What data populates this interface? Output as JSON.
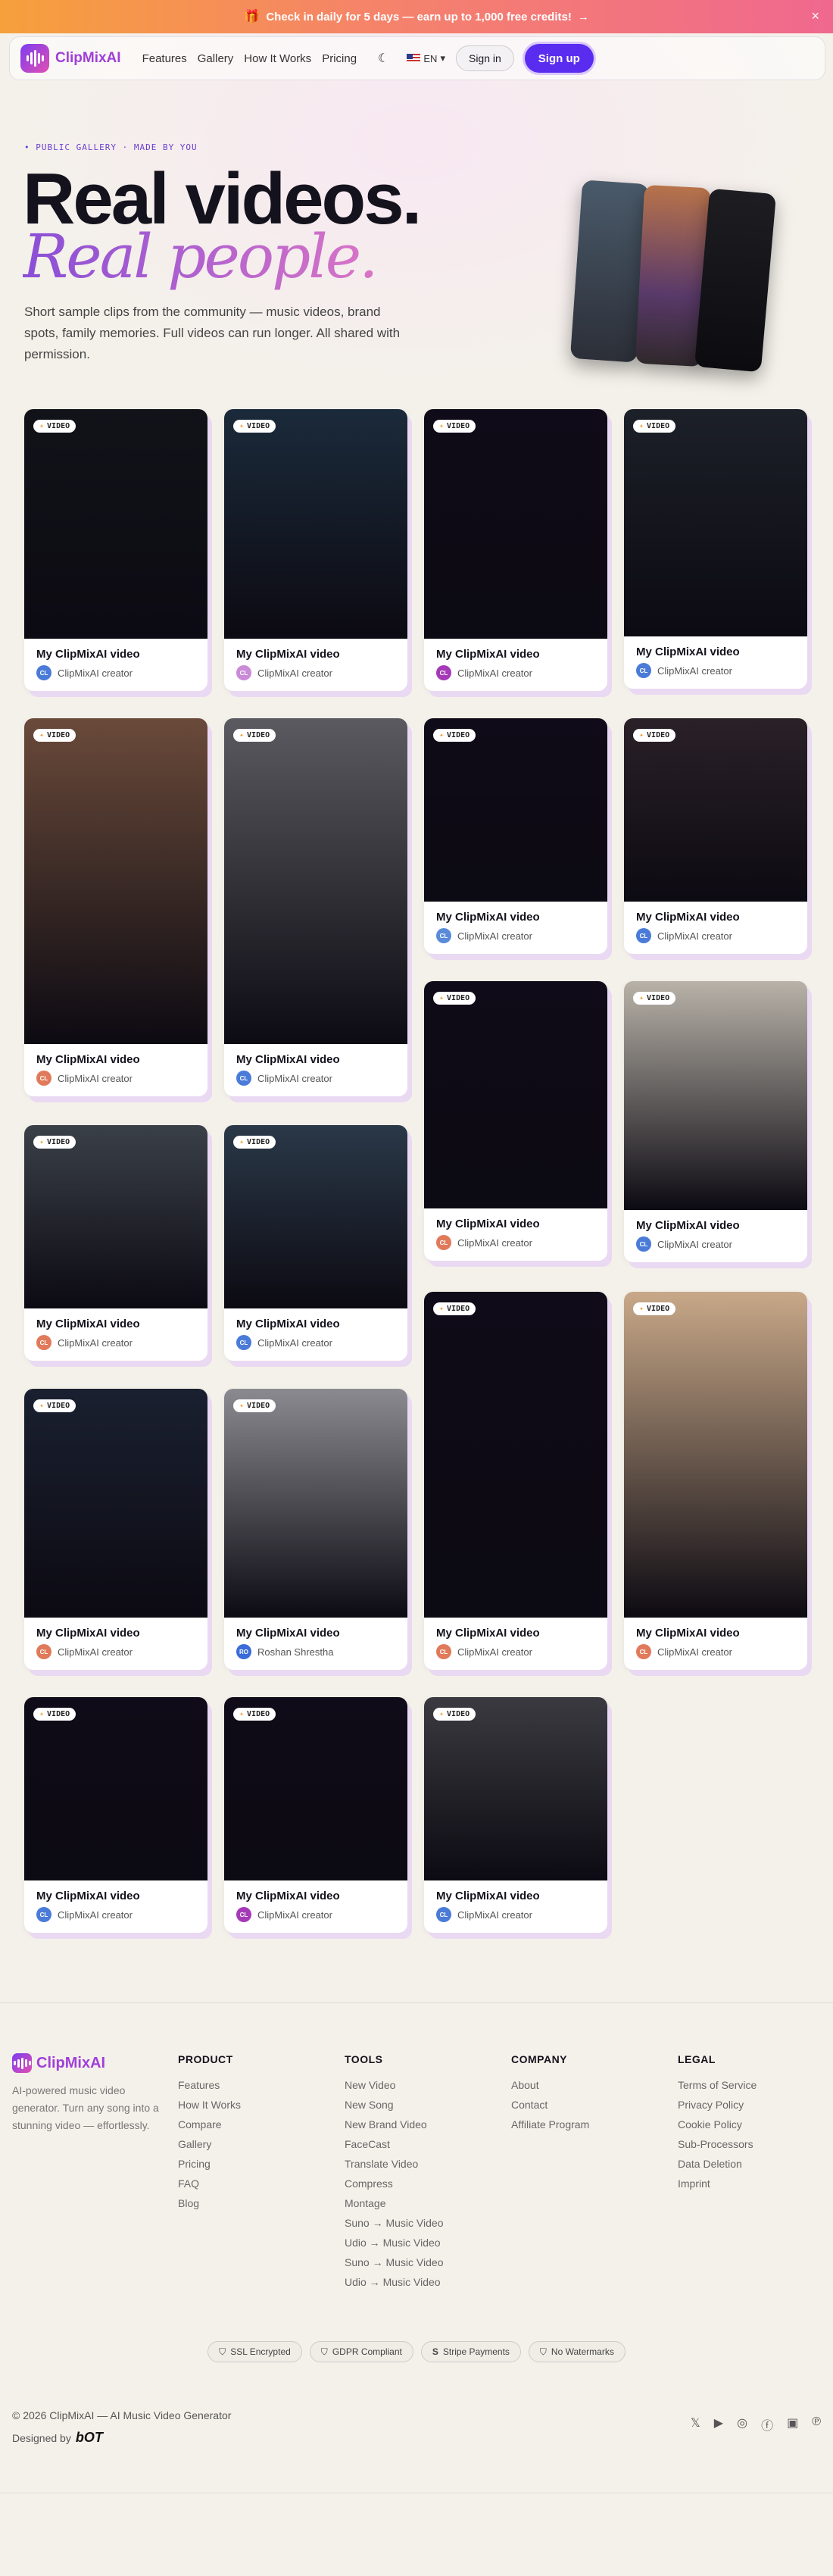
{
  "banner": {
    "icon": "gift-icon",
    "text": "Check in daily for 5 days — earn up to 1,000 free credits!",
    "arrow": "→",
    "close": "×"
  },
  "nav": {
    "brand": "ClipMixAI",
    "links": [
      "Features",
      "Gallery",
      "How It Works",
      "Pricing"
    ],
    "theme_icon": "moon-icon",
    "lang": "EN",
    "signin": "Sign in",
    "signup": "Sign up"
  },
  "hero": {
    "eyebrow": "• PUBLIC GALLERY · MADE BY YOU",
    "title_line1": "Real videos.",
    "title_line2": "Real people.",
    "lede": "Short sample clips from the community — music videos, brand spots, family memories. Full videos can run longer. All shared with permission."
  },
  "cards": [
    {
      "badge": "VIDEO",
      "title": "My ClipMixAI video",
      "author": "ClipMixAI creator",
      "initials": "CL",
      "avatar": "#4a7bd8",
      "thumb": "#111319"
    },
    {
      "badge": "VIDEO",
      "title": "My ClipMixAI video",
      "author": "ClipMixAI creator",
      "initials": "CL",
      "avatar": "#c98ad8",
      "thumb": "#1b2a3a"
    },
    {
      "badge": "VIDEO",
      "title": "My ClipMixAI video",
      "author": "ClipMixAI creator",
      "initials": "CL",
      "avatar": "#a53ab8",
      "thumb": "#0f0b18"
    },
    {
      "badge": "VIDEO",
      "title": "My ClipMixAI video",
      "author": "ClipMixAI creator",
      "initials": "CL",
      "avatar": "#4a7bd8",
      "thumb": "#1c2028"
    },
    {
      "badge": "VIDEO",
      "title": "My ClipMixAI video",
      "author": "ClipMixAI creator",
      "initials": "CL",
      "avatar": "#e07a5a",
      "thumb": "#6a4a3a"
    },
    {
      "badge": "VIDEO",
      "title": "My ClipMixAI video",
      "author": "ClipMixAI creator",
      "initials": "CL",
      "avatar": "#4a7bd8",
      "thumb": "#5a5a60"
    },
    {
      "badge": "VIDEO",
      "title": "My ClipMixAI video",
      "author": "ClipMixAI creator",
      "initials": "CL",
      "avatar": "#5a8bd8",
      "thumb": "#0f0b18"
    },
    {
      "badge": "VIDEO",
      "title": "My ClipMixAI video",
      "author": "ClipMixAI creator",
      "initials": "CL",
      "avatar": "#4a7bd8",
      "thumb": "#2a2028"
    },
    {
      "badge": "VIDEO",
      "title": "My ClipMixAI video",
      "author": "ClipMixAI creator",
      "initials": "CL",
      "avatar": "#e07a5a",
      "thumb": "#0f0b18"
    },
    {
      "badge": "VIDEO",
      "title": "My ClipMixAI video",
      "author": "ClipMixAI creator",
      "initials": "CL",
      "avatar": "#4a7bd8",
      "thumb": "#b8b2a8"
    },
    {
      "badge": "VIDEO",
      "title": "My ClipMixAI video",
      "author": "ClipMixAI creator",
      "initials": "CL",
      "avatar": "#e07a5a",
      "thumb": "#3a4048"
    },
    {
      "badge": "VIDEO",
      "title": "My ClipMixAI video",
      "author": "ClipMixAI creator",
      "initials": "CL",
      "avatar": "#4a7bd8",
      "thumb": "#2a3848"
    },
    {
      "badge": "VIDEO",
      "title": "My ClipMixAI video",
      "author": "ClipMixAI creator",
      "initials": "CL",
      "avatar": "#e07a5a",
      "thumb": "#0f0b18"
    },
    {
      "badge": "VIDEO",
      "title": "My ClipMixAI video",
      "author": "ClipMixAI creator",
      "initials": "CL",
      "avatar": "#a53ab8",
      "thumb": "#6a5a48"
    },
    {
      "badge": "VIDEO",
      "title": "My ClipMixAI video",
      "author": "ClipMixAI creator",
      "initials": "CL",
      "avatar": "#e07a5a",
      "thumb": "#1a2030"
    },
    {
      "badge": "VIDEO",
      "title": "My ClipMixAI video",
      "author": "Roshan Shrestha",
      "initials": "RO",
      "avatar": "#3a6bd8",
      "thumb": "#8a8a90"
    },
    {
      "badge": "VIDEO",
      "title": "My ClipMixAI video",
      "author": "ClipMixAI creator",
      "initials": "CL",
      "avatar": "#e07a5a",
      "thumb": "#0f0b18"
    },
    {
      "badge": "VIDEO",
      "title": "My ClipMixAI video",
      "author": "ClipMixAI creator",
      "initials": "CL",
      "avatar": "#e07a5a",
      "thumb": "#c8a888"
    },
    {
      "badge": "VIDEO",
      "title": "My ClipMixAI video",
      "author": "ClipMixAI creator",
      "initials": "CL",
      "avatar": "#4a7bd8",
      "thumb": "#0f0b18"
    },
    {
      "badge": "VIDEO",
      "title": "My ClipMixAI video",
      "author": "ClipMixAI creator",
      "initials": "CL",
      "avatar": "#a53ab8",
      "thumb": "#0f0b18"
    },
    {
      "badge": "VIDEO",
      "title": "My ClipMixAI video",
      "author": "ClipMixAI creator",
      "initials": "CL",
      "avatar": "#4a7bd8",
      "thumb": "#3a3a40"
    }
  ],
  "footer": {
    "brand": "ClipMixAI",
    "tagline": "AI-powered music video generator. Turn any song into a stunning video — effortlessly.",
    "columns": [
      {
        "heading": "PRODUCT",
        "links": [
          "Features",
          "How It Works",
          "Compare",
          "Gallery",
          "Pricing",
          "FAQ",
          "Blog"
        ]
      },
      {
        "heading": "TOOLS",
        "links": [
          "New Video",
          "New Song",
          "New Brand Video",
          "FaceCast",
          "Translate Video",
          "Compress",
          "Montage",
          "Suno → Music Video",
          "Udio → Music Video",
          "Suno → Music Video",
          "Udio → Music Video"
        ]
      },
      {
        "heading": "COMPANY",
        "links": [
          "About",
          "Contact",
          "Affiliate Program"
        ]
      },
      {
        "heading": "LEGAL",
        "links": [
          "Terms of Service",
          "Privacy Policy",
          "Cookie Policy",
          "Sub-Processors",
          "Data Deletion",
          "Imprint"
        ]
      }
    ],
    "badges": [
      "SSL Encrypted",
      "GDPR Compliant",
      "Stripe Payments",
      "No Watermarks"
    ],
    "copyright": "© 2026 ClipMixAI — AI Music Video Generator",
    "designed_by": "Designed by",
    "designer": "bOT",
    "socials": [
      "x-icon",
      "youtube-icon",
      "instagram-icon",
      "facebook-icon",
      "linkedin-icon",
      "pinterest-icon"
    ]
  }
}
